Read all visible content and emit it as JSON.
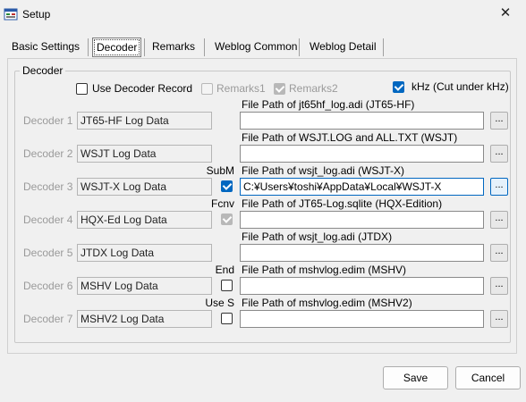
{
  "window": {
    "title": "Setup",
    "close_glyph": "✕"
  },
  "tabs": [
    {
      "label": "Basic Settings",
      "active": false
    },
    {
      "label": "Decoder",
      "active": true
    },
    {
      "label": "Remarks",
      "active": false
    },
    {
      "label": "Weblog Common",
      "active": false
    },
    {
      "label": "Weblog Detail",
      "active": false
    }
  ],
  "group": {
    "legend": "Decoder"
  },
  "options": {
    "use_decoder_record": {
      "label": "Use Decoder Record",
      "checked": false
    },
    "remarks1": {
      "label": "Remarks1",
      "checked": false,
      "enabled": false
    },
    "remarks2": {
      "label": "Remarks2",
      "checked": true,
      "enabled": false
    },
    "khz": {
      "label": "kHz (Cut under kHz)",
      "checked": true
    }
  },
  "decoders": [
    {
      "label": "Decoder 1",
      "name": "JT65-HF Log Data",
      "side_label": "",
      "checkbox": null,
      "path_caption": "File Path of jt65hf_log.adi (JT65-HF)",
      "path_value": "",
      "browse": "..."
    },
    {
      "label": "Decoder 2",
      "name": "WSJT Log Data",
      "side_label": "",
      "checkbox": null,
      "path_caption": "File Path of WSJT.LOG and ALL.TXT (WSJT)",
      "path_value": "",
      "browse": "..."
    },
    {
      "label": "Decoder 3",
      "name": "WSJT-X Log Data",
      "side_label": "SubM",
      "checkbox": {
        "checked": true,
        "enabled": true
      },
      "path_caption": "File Path of wsjt_log.adi (WSJT-X)",
      "path_value": "C:¥Users¥toshi¥AppData¥Local¥WSJT-X",
      "browse": "..."
    },
    {
      "label": "Decoder 4",
      "name": "HQX-Ed Log Data",
      "side_label": "Fcnv",
      "checkbox": {
        "checked": true,
        "enabled": false
      },
      "path_caption": "File Path of JT65-Log.sqlite (HQX-Edition)",
      "path_value": "",
      "browse": "..."
    },
    {
      "label": "Decoder 5",
      "name": "JTDX Log Data",
      "side_label": "",
      "checkbox": null,
      "path_caption": "File Path of wsjt_log.adi (JTDX)",
      "path_value": "",
      "browse": "..."
    },
    {
      "label": "Decoder 6",
      "name": "MSHV Log Data",
      "side_label": "End",
      "checkbox": {
        "checked": false,
        "enabled": true
      },
      "path_caption": "File Path of mshvlog.edim (MSHV)",
      "path_value": "",
      "browse": "..."
    },
    {
      "label": "Decoder 7",
      "name": "MSHV2 Log Data",
      "side_label": "Use S",
      "checkbox": {
        "checked": false,
        "enabled": true
      },
      "path_caption": "File Path of mshvlog.edim (MSHV2)",
      "path_value": "",
      "browse": "..."
    }
  ],
  "footer": {
    "save_label": "Save",
    "cancel_label": "Cancel"
  }
}
